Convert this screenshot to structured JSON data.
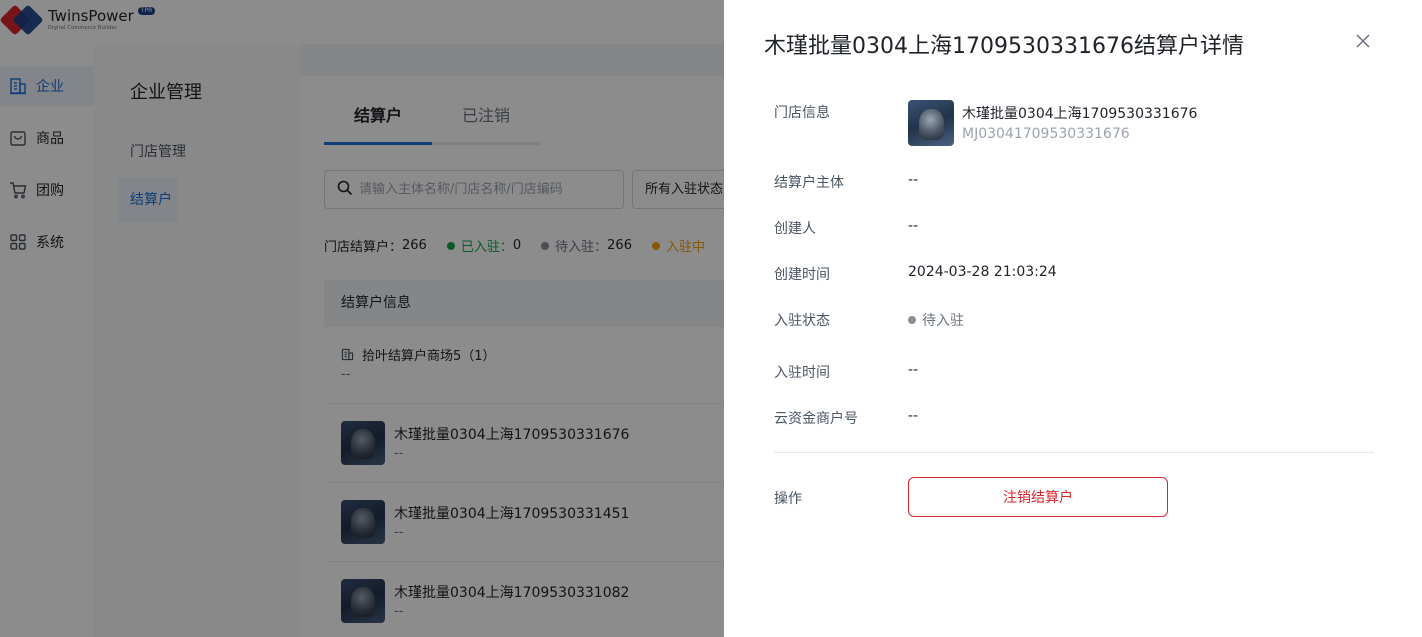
{
  "colors": {
    "accent": "#1e6fd9",
    "danger": "#d8262e",
    "onboarded": "#16a34a",
    "pending": "#8a8f99",
    "processing": "#f59e0b"
  },
  "brand": {
    "name": "TwinsPower",
    "badge": "TPR",
    "tagline": "Digital Commerce Builder"
  },
  "sidebar": {
    "items": [
      {
        "label": "企业",
        "icon": "building-icon",
        "active": true
      },
      {
        "label": "商品",
        "icon": "bag-icon",
        "active": false
      },
      {
        "label": "团购",
        "icon": "cart-icon",
        "active": false
      },
      {
        "label": "系统",
        "icon": "grid-icon",
        "active": false
      }
    ]
  },
  "subnav": {
    "title": "企业管理",
    "items": [
      {
        "label": "门店管理"
      },
      {
        "label": "结算户"
      }
    ]
  },
  "main": {
    "tabs": [
      {
        "label": "结算户"
      },
      {
        "label": "已注销"
      }
    ],
    "search": {
      "placeholder": "请输入主体名称/门店名称/门店编码"
    },
    "filter": {
      "value": "所有入驻状态"
    },
    "stats": {
      "total_label": "门店结算户：",
      "total": "266",
      "onboarded_label": "已入驻：",
      "onboarded": "0",
      "pending_label": "待入驻：",
      "pending": "266",
      "processing_label": "入驻中"
    },
    "table": {
      "header": "结算户信息",
      "group": {
        "name": "拾叶结算户商场5（1）",
        "sub": "--"
      },
      "rows": [
        {
          "name": "木瑾批量0304上海1709530331676",
          "sub": "--"
        },
        {
          "name": "木瑾批量0304上海1709530331451",
          "sub": "--"
        },
        {
          "name": "木瑾批量0304上海1709530331082",
          "sub": "--"
        }
      ]
    }
  },
  "drawer": {
    "title": "木瑾批量0304上海1709530331676结算户详情",
    "fields": {
      "store_info": {
        "label": "门店信息",
        "name": "木瑾批量0304上海1709530331676",
        "code": "MJ03041709530331676"
      },
      "entity": {
        "label": "结算户主体",
        "value": "--"
      },
      "creator": {
        "label": "创建人",
        "value": "--"
      },
      "created_at": {
        "label": "创建时间",
        "value": "2024-03-28 21:03:24"
      },
      "onboard_status": {
        "label": "入驻状态",
        "value": "待入驻"
      },
      "onboard_time": {
        "label": "入驻时间",
        "value": "--"
      },
      "merchant_no": {
        "label": "云资金商户号",
        "value": "--"
      },
      "action": {
        "label": "操作"
      }
    },
    "cancel_button": "注销结算户"
  }
}
